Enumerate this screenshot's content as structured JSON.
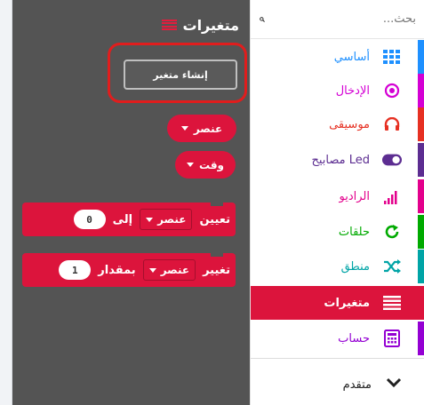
{
  "flyout": {
    "title": "متغيرات",
    "create_variable_label": "إنشاء متغير",
    "reporters": [
      {
        "label": "عنصر"
      },
      {
        "label": "وقت"
      }
    ],
    "set_block": {
      "keyword": "تعيين",
      "variable": "عنصر",
      "to_label": "إلى",
      "value": "0"
    },
    "change_block": {
      "keyword": "تغيير",
      "variable": "عنصر",
      "by_label": "بمقدار",
      "value": "1"
    }
  },
  "toolbox": {
    "search_placeholder": "بحث...",
    "categories": [
      {
        "label": "أساسي",
        "color": "#1e90ff",
        "icon": "grid-icon"
      },
      {
        "label": "الإدخال",
        "color": "#d400d4",
        "icon": "target-icon"
      },
      {
        "label": "موسيقى",
        "color": "#e63022",
        "icon": "headphones-icon"
      },
      {
        "label": "مصابيح Led",
        "color": "#5c2d91",
        "icon": "toggle-icon"
      },
      {
        "label": "الراديو",
        "color": "#e3008c",
        "icon": "signal-bars-icon"
      },
      {
        "label": "حلقات",
        "color": "#00aa00",
        "icon": "refresh-icon"
      },
      {
        "label": "منطق",
        "color": "#00a4a6",
        "icon": "shuffle-icon"
      },
      {
        "label": "متغيرات",
        "color": "#dc143c",
        "icon": "list-icon",
        "selected": true
      },
      {
        "label": "حساب",
        "color": "#9400d3",
        "icon": "calculator-icon"
      }
    ],
    "advanced_label": "متقدم"
  }
}
